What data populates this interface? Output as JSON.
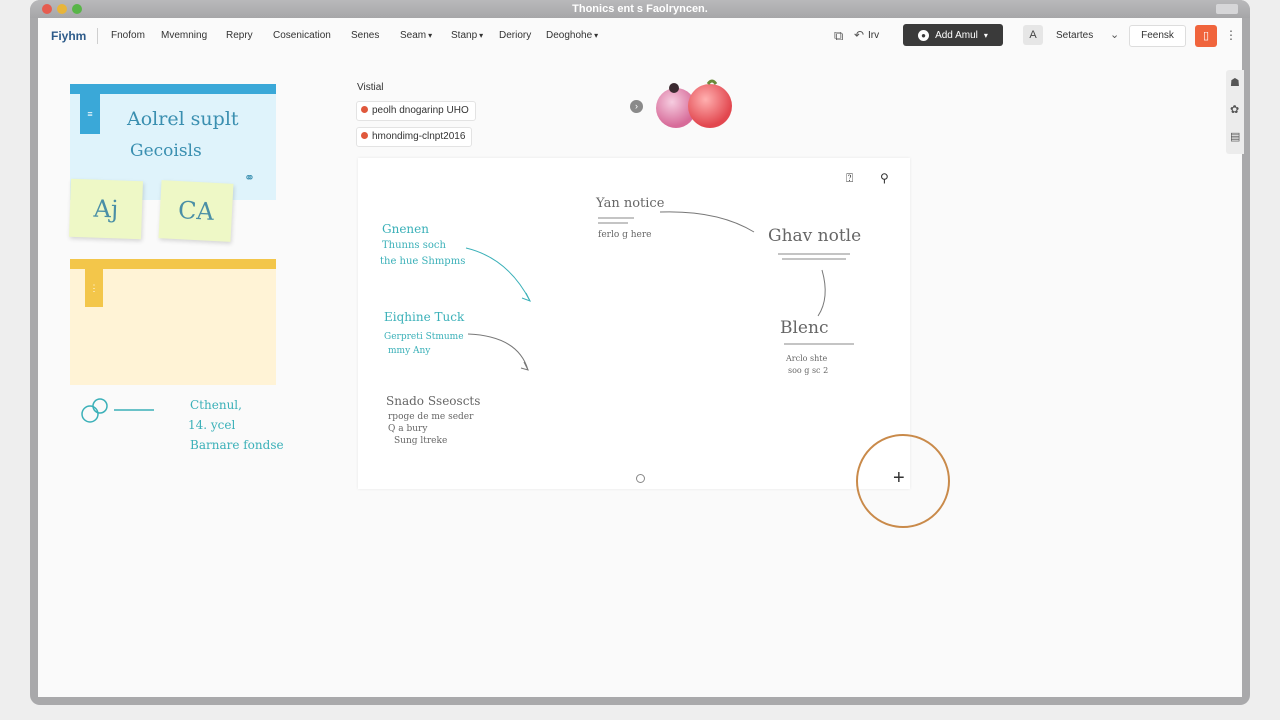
{
  "window": {
    "title": "Thonics ent s Faolryncen."
  },
  "toolbar": {
    "logo": "Fiyhm",
    "menu": [
      "Fnofom",
      "Mvemning",
      "Repry",
      "Cosenication",
      "Senes",
      "Seam",
      "Stanp",
      "Deriory",
      "Deoghohe"
    ],
    "menu_carets": {
      "5": true,
      "6": true,
      "8": true
    },
    "inv_label": "Irv",
    "add_button": "Add Amul",
    "avatar_letter": "A",
    "settings_label": "Setartes",
    "search_text": "Feensk"
  },
  "canvas": {
    "blue_note": {
      "line1": "Aolrel suplt",
      "line2": "Gecoisls"
    },
    "stickies": [
      "Aj",
      "CA"
    ],
    "left_notes": [
      "Cthenul,",
      "14. ycel",
      "Barnare fondse"
    ],
    "visual_label": "Vistial",
    "chips": [
      "peolh dnogarinp UHO",
      "hmondimg-clnpt2016"
    ],
    "board": {
      "notes_left": [
        {
          "title": "Gnenen",
          "l1": "Thunns soch",
          "l2": "the hue Shmpms"
        },
        {
          "title": "Eiqhine Tuck",
          "l1": "Gerpreti Stmume",
          "l2": "mmy Any"
        },
        {
          "title": "Snado Sseoscts",
          "l1": "rpoge de me seder",
          "l2": "Q a bury",
          "l3": "Sung ltreke"
        }
      ],
      "note_top": {
        "title": "Yan notice",
        "l1": "ferlo g here"
      },
      "note_right": {
        "title": "Ghav notle"
      },
      "note_blenc": {
        "title": "Blenc",
        "l1": "Arclo shte",
        "l2": "soo g sc 2"
      }
    }
  },
  "colors": {
    "accent_orange": "#f0643c",
    "note_blue": "#3aa8d8",
    "note_yellow": "#f3c64a",
    "cursor_ring": "#c98a4a"
  },
  "icons": [
    "crop-edit-icon",
    "undo-icon",
    "globe-icon",
    "mobile-icon",
    "menu-dots-icon",
    "help-icon",
    "share-icon",
    "person-icon",
    "paint-icon",
    "trash-icon",
    "crosshair-icon"
  ]
}
